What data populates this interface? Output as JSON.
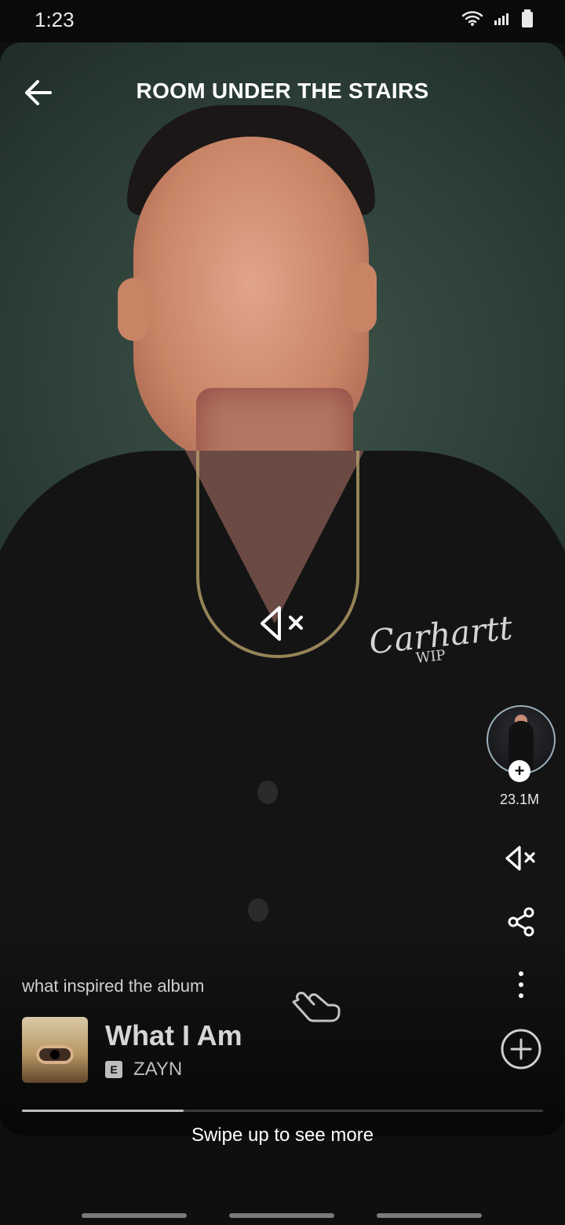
{
  "status": {
    "time": "1:23",
    "icons": [
      "wifi-icon",
      "signal-icon",
      "battery-icon"
    ]
  },
  "header": {
    "title": "ROOM UNDER THE STAIRS",
    "back_icon": "arrow-left-icon"
  },
  "media": {
    "muted": true,
    "brand_text": "Carhartt",
    "brand_sub": "WIP"
  },
  "side_actions": {
    "follower_count": "23.1M",
    "icons": [
      "avatar",
      "plus-icon",
      "mute-icon",
      "share-icon",
      "more-vertical-icon"
    ]
  },
  "caption": "what inspired the album",
  "track": {
    "title": "What I Am",
    "explicit_label": "E",
    "artist": "ZAYN",
    "progress_percent": 31
  },
  "footer": {
    "swipe_text": "Swipe up to see more"
  },
  "colors": {
    "background": "#0f0f10",
    "accent_text": "#ffffff",
    "muted_text": "#bdbdbd"
  }
}
